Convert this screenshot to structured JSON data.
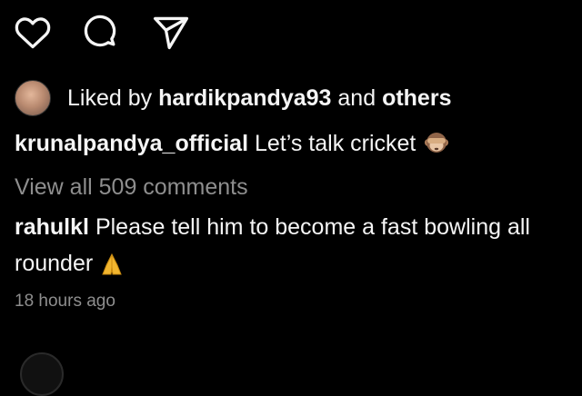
{
  "post": {
    "actions": {
      "like_icon": "heart-icon",
      "comment_icon": "comment-bubble-icon",
      "share_icon": "paper-plane-icon"
    },
    "likes": {
      "prefix": "Liked by",
      "user": "hardikpandya93",
      "joiner": "and",
      "others": "others"
    },
    "caption": {
      "username": "krunalpandya_official",
      "text": "Let’s talk cricket",
      "emoji": "see-no-evil-monkey-icon"
    },
    "view_all_comments": "View all 509 comments",
    "comment": {
      "username": "rahulkl",
      "text": "Please tell him to become a fast bowling all rounder",
      "emoji": "folded-hands-icon"
    },
    "timestamp": "18 hours ago"
  },
  "colors": {
    "background": "#000000",
    "text": "#f5f5f5",
    "muted": "#8e8e8e"
  }
}
